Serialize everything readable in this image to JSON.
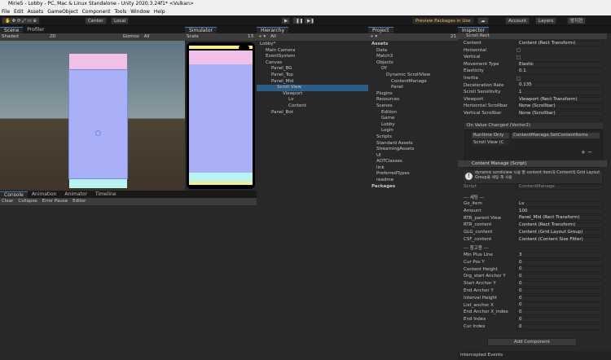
{
  "window": {
    "title": "Mirie5 - Lobby - PC, Mac & Linux Standalone - Unity 2020.3.24f1* <Vulkan>"
  },
  "menu": [
    "File",
    "Edit",
    "Assets",
    "GameObject",
    "Component",
    "Tools",
    "Window",
    "Help"
  ],
  "toolbar": {
    "center": "Center",
    "local": "Local",
    "preview": "Preview Packages in Use",
    "account": "Account",
    "layers": "Layers",
    "layout": "방지현"
  },
  "scene": {
    "tabs": [
      "Scene",
      "Profiler"
    ],
    "shading": "Shaded",
    "mode": "2D",
    "gizmos": "Gizmos",
    "search": "All"
  },
  "simulator": {
    "tab": "Simulator",
    "scale_label": "Scale",
    "scale_value": "13"
  },
  "console": {
    "tabs": [
      "Console",
      "Animation",
      "Animator",
      "Timeline"
    ],
    "buttons": [
      "Clear",
      "Collapse",
      "Error Pause",
      "Editor"
    ]
  },
  "hierarchy": {
    "tab": "Hierarchy",
    "search": "All",
    "items": [
      {
        "label": "Lobby*",
        "depth": 0
      },
      {
        "label": "Main Camera",
        "depth": 1
      },
      {
        "label": "EventSystem",
        "depth": 1
      },
      {
        "label": "Canvas",
        "depth": 1
      },
      {
        "label": "Panel_BG",
        "depth": 2
      },
      {
        "label": "Panel_Top",
        "depth": 2
      },
      {
        "label": "Panel_Mid",
        "depth": 2
      },
      {
        "label": "Scroll View",
        "depth": 3
      },
      {
        "label": "Viewport",
        "depth": 4
      },
      {
        "label": "Lv",
        "depth": 5
      },
      {
        "label": "Content",
        "depth": 5
      },
      {
        "label": "Panel_Bot",
        "depth": 2
      }
    ]
  },
  "project": {
    "tab": "Project",
    "count": "21",
    "items": [
      {
        "label": "Assets",
        "depth": 0
      },
      {
        "label": "Data",
        "depth": 1
      },
      {
        "label": "Match3",
        "depth": 1
      },
      {
        "label": "Objects",
        "depth": 1
      },
      {
        "label": "DY",
        "depth": 2
      },
      {
        "label": "Dynamic ScrollView",
        "depth": 3
      },
      {
        "label": "ContentManage",
        "depth": 4
      },
      {
        "label": "Panel",
        "depth": 4
      },
      {
        "label": "Plugins",
        "depth": 1
      },
      {
        "label": "Resources",
        "depth": 1
      },
      {
        "label": "Scenes",
        "depth": 1
      },
      {
        "label": "Edition",
        "depth": 2
      },
      {
        "label": "Game",
        "depth": 2
      },
      {
        "label": "Lobby",
        "depth": 2
      },
      {
        "label": "Login",
        "depth": 2
      },
      {
        "label": "Scripts",
        "depth": 1
      },
      {
        "label": "Standard Assets",
        "depth": 1
      },
      {
        "label": "StreamingAssets",
        "depth": 1
      },
      {
        "label": "UI",
        "depth": 1
      },
      {
        "label": "AOTClasses",
        "depth": 1
      },
      {
        "label": "link",
        "depth": 1
      },
      {
        "label": "PreferredTypes",
        "depth": 1
      },
      {
        "label": "readme",
        "depth": 1
      },
      {
        "label": "Packages",
        "depth": 0
      }
    ]
  },
  "inspector": {
    "tab": "Inspector",
    "component1": "Scroll Rect",
    "rows1": [
      {
        "label": "Content",
        "value": "Content (Rect Transform)"
      },
      {
        "label": "Horizontal",
        "value": ""
      },
      {
        "label": "Vertical",
        "value": ""
      },
      {
        "label": "Movement Type",
        "value": "Elastic"
      },
      {
        "label": "Elasticity",
        "value": "0.1"
      },
      {
        "label": "Inertia",
        "value": ""
      },
      {
        "label": "Deceleration Rate",
        "value": "0.135"
      },
      {
        "label": "Scroll Sensitivity",
        "value": "1"
      },
      {
        "label": "Viewport",
        "value": "Viewport (Rect Transform)"
      },
      {
        "label": "Horizontal Scrollbar",
        "value": "None (Scrollbar)"
      },
      {
        "label": "Vertical Scrollbar",
        "value": "None (Scrollbar)"
      }
    ],
    "event_header": "On Value Changed (Vector2)",
    "runtime": "Runtime Only",
    "function": "ContentManage.SetContentItems",
    "object": "Scroll View (C",
    "component2": "Content Manage (Script)",
    "info": "dynamic scrollview 사용 할 content item과 Content의 Grid Layout Group을 세팅 해 사용",
    "script_label": "Script",
    "script_value": "ContentManage",
    "section1": "--- 세팅 ---",
    "rows2": [
      {
        "label": "Go_item",
        "value": "Lv"
      },
      {
        "label": "Amount",
        "value": "100"
      },
      {
        "label": "RTR_parent View",
        "value": "Panel_Mid (Rect Transform)"
      },
      {
        "label": "RTR_content",
        "value": "Content (Rect Transform)"
      },
      {
        "label": "GLG_content",
        "value": "Content (Grid Layout Group)"
      },
      {
        "label": "CSF_content",
        "value": "Content (Content Size Fitter)"
      }
    ],
    "section2": "--- 참고용 ---",
    "rows3": [
      {
        "label": "Min Plus Line",
        "value": "3"
      },
      {
        "label": "Cur Pos Y",
        "value": "0"
      },
      {
        "label": "Content Height",
        "value": "0"
      },
      {
        "label": "Org_start Anchor Y",
        "value": "0"
      },
      {
        "label": "Start Anchor Y",
        "value": "0"
      },
      {
        "label": "End Anchor Y",
        "value": "0"
      },
      {
        "label": "Interval Height",
        "value": "0"
      },
      {
        "label": "List_anchor X",
        "value": "0"
      },
      {
        "label": "End Anchor X_index",
        "value": "0"
      },
      {
        "label": "End Index",
        "value": "0"
      },
      {
        "label": "Cur Index",
        "value": "0"
      }
    ],
    "add_component": "Add Component",
    "footer": "Intercepted Events"
  }
}
